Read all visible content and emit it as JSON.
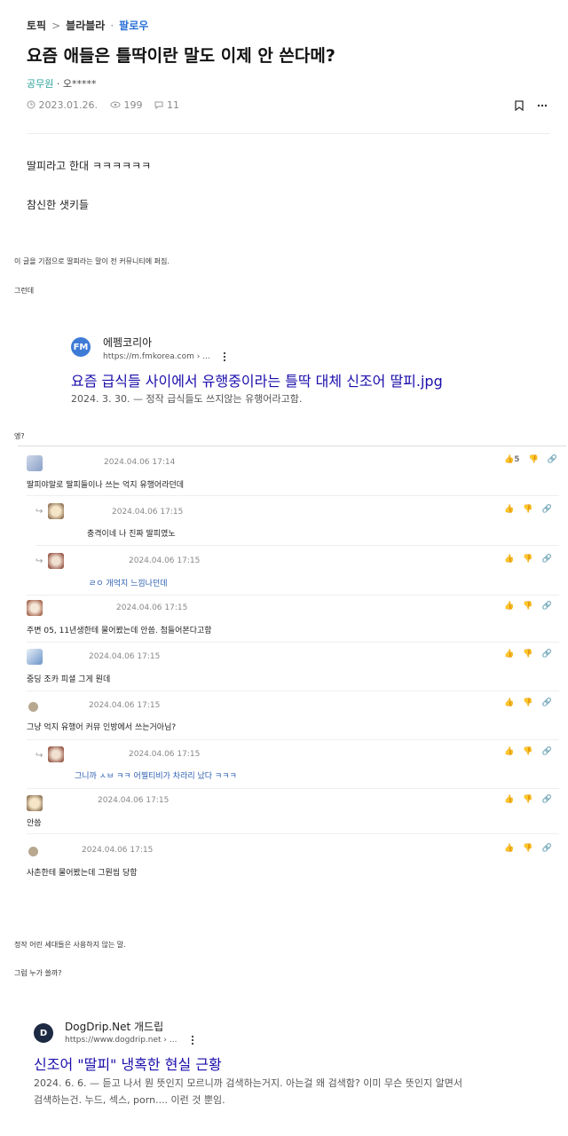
{
  "breadcrumb": {
    "topic": "토픽",
    "sep": ">",
    "board": "블라블라",
    "dot": "·",
    "follow": "팔로우"
  },
  "post": {
    "title": "요즘 애들은 틀딱이란 말도 이제 안 쓴다메?",
    "author_job": "공무원",
    "author_name": "· 오*****",
    "date": "2023.01.26.",
    "views": "199",
    "comments": "11",
    "line1": "딸피라고 한대 ㅋㅋㅋㅋㅋㅋ",
    "line2": "참신한 샛키들",
    "caption1": "이 글을 기점으로 딸피라는 말이 전 커뮤니티에 퍼짐.",
    "caption2": "그런데",
    "caption3": "엥?",
    "caption4": "정작 어린 세대들은 사용하지 않는 말.",
    "caption5": "그럼 누가 쓸까?"
  },
  "serp1": {
    "logo": "FM",
    "site": "에펨코리아",
    "url": "https://m.fmkorea.com › ...",
    "title": "요즘 급식들 사이에서 유행중이라는 틀딱 대체 신조어 딸피.jpg",
    "snippet": "2024. 3. 30. — 정작 급식들도 쓰지않는 유행어라고함."
  },
  "comments": [
    {
      "time": "2024.04.06 17:14",
      "text": "딸피야말로 딸피들이나 쓰는 억지 유행어라던데",
      "likes": "5"
    },
    {
      "time": "2024.04.06 17:15",
      "text": "충격이네 나 진짜 딸피였노",
      "likes": ""
    },
    {
      "time": "2024.04.06 17:15",
      "text": "ㄹㅇ 개억지 느낌나던데",
      "likes": ""
    },
    {
      "time": "2024.04.06 17:15",
      "text": "주변 05, 11년생한테 물어봤는데 안씀. 첨들어본다고함",
      "likes": ""
    },
    {
      "time": "2024.04.06 17:15",
      "text": "중딩 조카 피셜 그게 뭔데",
      "likes": ""
    },
    {
      "time": "2024.04.06 17:15",
      "text": "그냥 억지 유행어 커뮤 인방에서 쓰는거아님?",
      "likes": ""
    },
    {
      "time": "2024.04.06 17:15",
      "text": "그니까 ㅅㅂ ㅋㅋ 어찔티비가 차라리 났다 ㅋㅋㅋ",
      "likes": ""
    },
    {
      "time": "2024.04.06 17:15",
      "text": "안씀",
      "likes": ""
    },
    {
      "time": "2024.04.06 17:15",
      "text": "사촌한테 물어봤는데 그뭔씹 당함",
      "likes": ""
    }
  ],
  "serp2": {
    "logo": "D",
    "site": "DogDrip.Net 개드립",
    "url": "https://www.dogdrip.net › ...",
    "title": "신조어 \"딸피\" 냉혹한 현실 근황",
    "snippet1": "2024. 6. 6. — 듣고 나서 뭔 뜻인지 모르니까 검색하는거지. 아는걸 왜 검색함? 이미 무슨 뜻인지 알면서",
    "snippet2": "검색하는건. 누드, 섹스, porn.... 이런 것 뿐임."
  },
  "colors": {
    "link": "#1a0dab",
    "follow": "#2a6fd6",
    "job": "#2aa198",
    "fm_logo": "#3d7bd6",
    "dd_logo": "#1d2a44"
  },
  "icons": [
    "clock-icon",
    "eye-icon",
    "comment-icon",
    "bookmark-icon",
    "more-icon",
    "thumb-up-icon",
    "thumb-down-icon",
    "link-icon",
    "reply-arrow-icon",
    "kebab-icon"
  ]
}
